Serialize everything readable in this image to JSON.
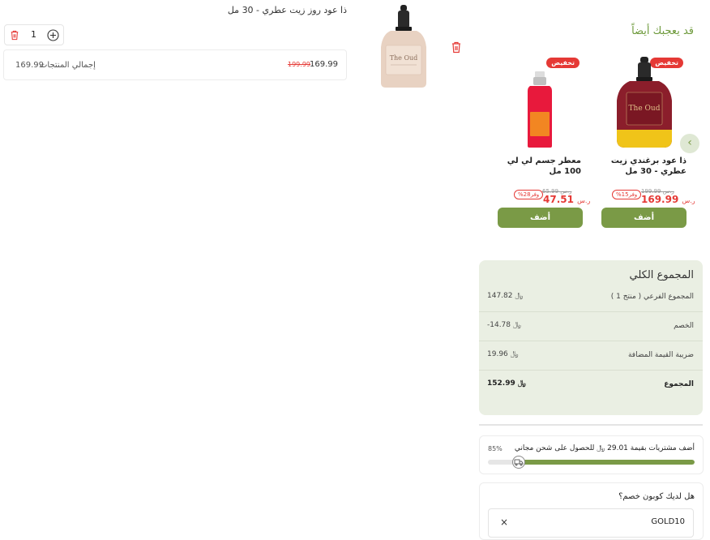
{
  "cart": {
    "item": {
      "title": "ذا عود روز زيت عطري - 30 مل",
      "quantity": "1",
      "price_old": "199.99",
      "price_new": "169.99",
      "total_label": "إجمالي المنتجات",
      "total_value": "169.99"
    }
  },
  "recommendations": {
    "title": "قد يعجبك أيضاً",
    "add_label": "أضف",
    "products": [
      {
        "badge": "تخفيض",
        "name": "ذا عود برغندي زيت عطري - 30 مل",
        "price_new": "169.99",
        "currency": "ر.س",
        "price_old": "199.99",
        "price_old_currency": "ر.س",
        "save": "وفر15%"
      },
      {
        "badge": "تخفيض",
        "name": "معطر جسم لي لي 100 مل",
        "price_new": "47.51",
        "currency": "ر.س",
        "price_old": "65.99",
        "price_old_currency": "ر.س",
        "save": "وفر28%"
      }
    ]
  },
  "summary": {
    "title": "المجموع الكلي",
    "rows": [
      {
        "label": "المجموع الفرعي ( منتج 1 )",
        "value": "147.82 ﷼"
      },
      {
        "label": "الخصم",
        "value": "-14.78 ﷼"
      },
      {
        "label": "ضريبة القيمة المضافة",
        "value": "19.96 ﷼"
      },
      {
        "label": "المجموع",
        "value": "152.99 ﷼"
      }
    ]
  },
  "shipping": {
    "text": "أضف مشتريات بقيمة 29.01 ﷼ للحصول على شحن مجاني",
    "percent_label": "85%",
    "progress": 0.85
  },
  "coupon": {
    "question": "هل لديك كوبون خصم؟",
    "code": "GOLD10",
    "clear": "×"
  },
  "colors": {
    "accent": "#7a9a46",
    "sale": "#e53935",
    "summary_bg": "#eaefe3"
  }
}
